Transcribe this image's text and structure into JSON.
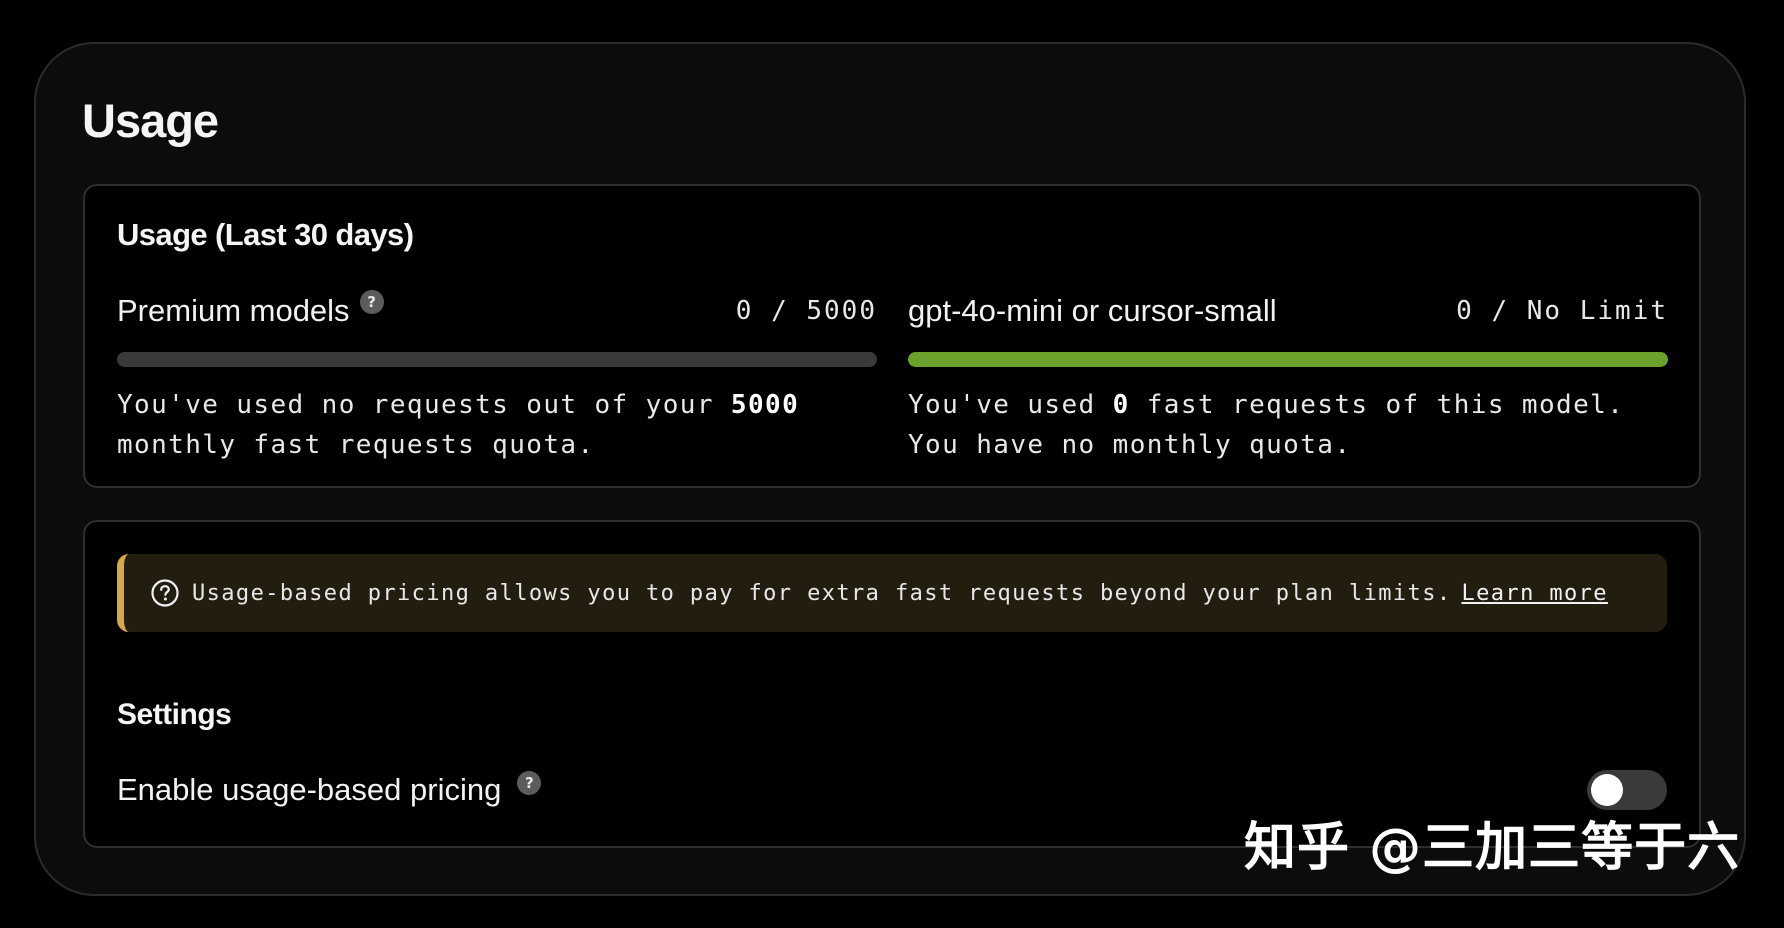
{
  "page": {
    "title": "Usage"
  },
  "usage_panel": {
    "title": "Usage (Last 30 days)",
    "premium": {
      "label": "Premium models",
      "help_icon": "question-mark-icon",
      "count": "0 / 5000",
      "progress_fraction": 0.0,
      "desc_part1": "You've used no requests out of your ",
      "desc_bold": "5000",
      "desc_part2": " monthly fast requests quota."
    },
    "small": {
      "label": "gpt-4o-mini or cursor-small",
      "count": "0 / No Limit",
      "progress_fraction": 1.0,
      "desc_part1": "You've used ",
      "desc_bold": "0",
      "desc_part2": " fast requests of this model. You have no monthly quota."
    }
  },
  "pricing_panel": {
    "callout": {
      "icon": "question-circle-icon",
      "text": "Usage-based pricing allows you to pay for extra fast requests beyond your plan limits.",
      "link": "Learn more"
    },
    "settings_title": "Settings",
    "usage_pricing": {
      "label": "Enable usage-based pricing",
      "help_icon": "question-mark-icon",
      "enabled": false
    }
  },
  "watermark": {
    "text": "知乎 @三加三等于六"
  },
  "colors": {
    "background": "#000000",
    "card": "#0c0c0c",
    "border": "#2e2e2e",
    "progress_track": "#3a3a3a",
    "progress_fill": "#6aa22c",
    "callout_bg": "#231d10",
    "callout_accent": "#d7a84a",
    "toggle_off": "#3a3a3a"
  }
}
